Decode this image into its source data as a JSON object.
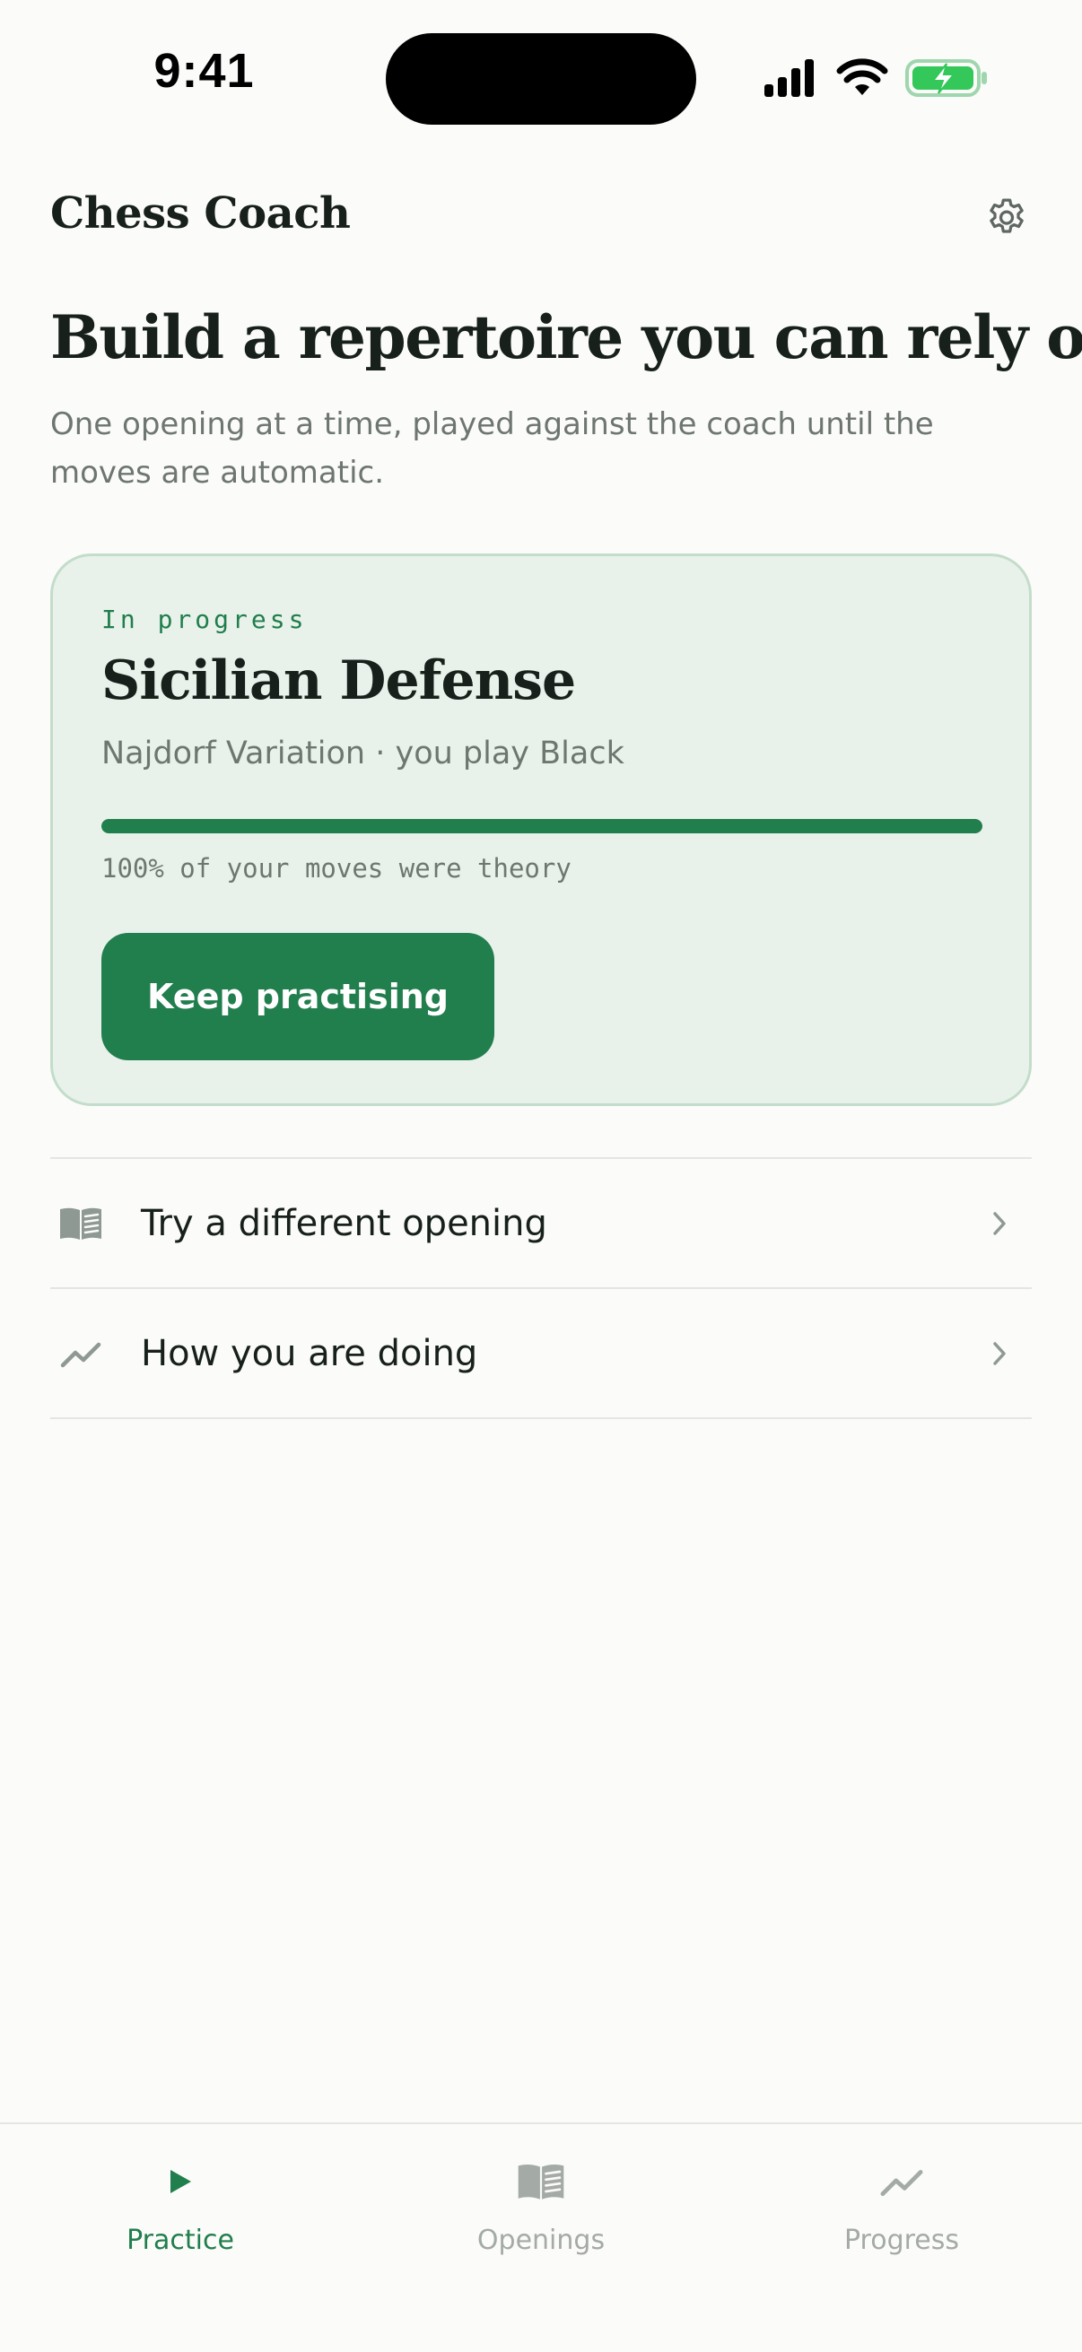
{
  "status_bar": {
    "time": "9:41"
  },
  "header": {
    "app_title": "Chess Coach",
    "settings_icon": "gear-icon"
  },
  "hero": {
    "title": "Build a repertoire you can rely on",
    "subtitle": "One opening at a time, played against the coach until the moves are automatic."
  },
  "current_opening": {
    "status": "In progress",
    "name": "Sicilian Defense",
    "detail": "Najdorf Variation · you play Black",
    "progress_percent": 100,
    "stat": "100% of your moves were theory",
    "button_label": "Keep practising"
  },
  "links": [
    {
      "label": "Try a different opening",
      "icon": "open-book-icon"
    },
    {
      "label": "How you are doing",
      "icon": "trend-line-icon"
    }
  ],
  "tabs": [
    {
      "label": "Practice",
      "icon": "play-icon",
      "active": true
    },
    {
      "label": "Openings",
      "icon": "open-book-icon",
      "active": false
    },
    {
      "label": "Progress",
      "icon": "trend-line-icon",
      "active": false
    }
  ],
  "colors": {
    "accent": "#217e4d",
    "card_background": "#e8f2ea",
    "card_border": "#c3ddca",
    "text_primary": "#17201b",
    "text_secondary": "#6e7670",
    "tab_inactive": "#a4aaa6",
    "battery_green": "#34c759"
  }
}
